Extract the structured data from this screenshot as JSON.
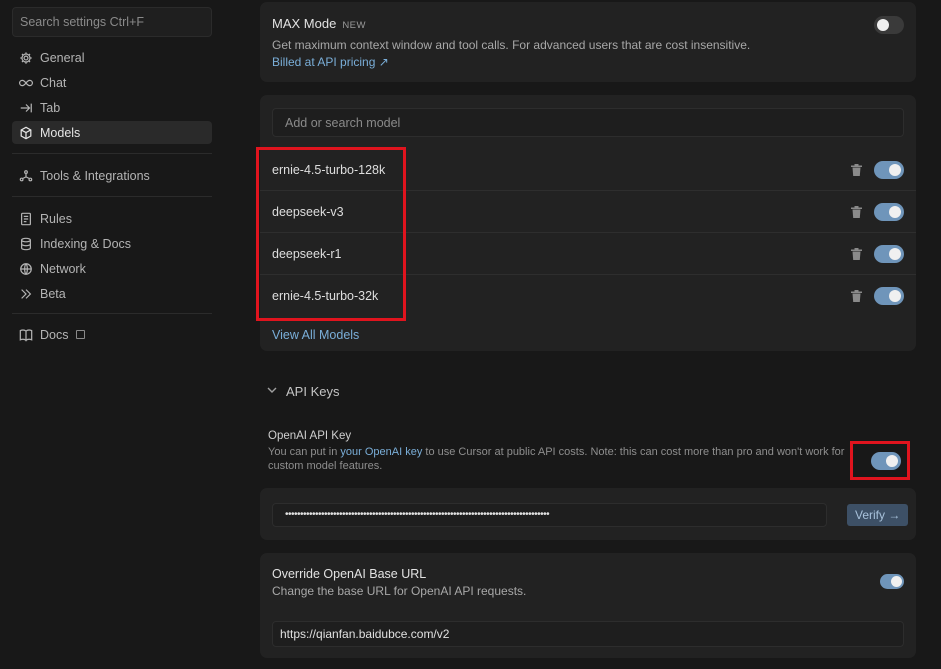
{
  "sidebar": {
    "search_placeholder": "Search settings Ctrl+F",
    "items": [
      {
        "label": "General",
        "icon": "gear-icon"
      },
      {
        "label": "Chat",
        "icon": "infinity-icon"
      },
      {
        "label": "Tab",
        "icon": "tab-arrow-icon"
      },
      {
        "label": "Models",
        "icon": "cube-icon"
      },
      {
        "label": "Tools & Integrations",
        "icon": "tools-icon"
      },
      {
        "label": "Rules",
        "icon": "rules-icon"
      },
      {
        "label": "Indexing & Docs",
        "icon": "database-icon"
      },
      {
        "label": "Network",
        "icon": "globe-icon"
      },
      {
        "label": "Beta",
        "icon": "double-chevron-icon"
      },
      {
        "label": "Docs",
        "icon": "book-icon"
      }
    ]
  },
  "max_mode": {
    "title": "MAX Mode",
    "badge": "NEW",
    "description": "Get maximum context window and tool calls. For advanced users that are cost insensitive.",
    "link": "Billed at API pricing ↗",
    "enabled": false
  },
  "models": {
    "search_placeholder": "Add or search model",
    "list": [
      {
        "name": "ernie-4.5-turbo-128k",
        "enabled": true
      },
      {
        "name": "deepseek-v3",
        "enabled": true
      },
      {
        "name": "deepseek-r1",
        "enabled": true
      },
      {
        "name": "ernie-4.5-turbo-32k",
        "enabled": true
      }
    ],
    "view_all": "View All Models"
  },
  "api_keys": {
    "section_title": "API Keys",
    "openai": {
      "title": "OpenAI API Key",
      "desc_pre": "You can put in ",
      "desc_link": "your OpenAI key",
      "desc_post": " to use Cursor at public API costs. Note: this can cost more than pro and won't work for",
      "desc_line2": "custom model features.",
      "enabled": true,
      "key_value": "••••••••••••••••••••••••••••••••••••••••••••••••••••••••••••••••••••••••••••••••••••••••",
      "verify_label": "Verify →"
    },
    "base_url": {
      "title": "Override OpenAI Base URL",
      "description": "Change the base URL for OpenAI API requests.",
      "enabled": true,
      "value": "https://qianfan.baidubce.com/v2"
    }
  },
  "colors": {
    "accent": "#6f95ba",
    "highlight": "#e0141e",
    "link": "#7aaed8"
  }
}
